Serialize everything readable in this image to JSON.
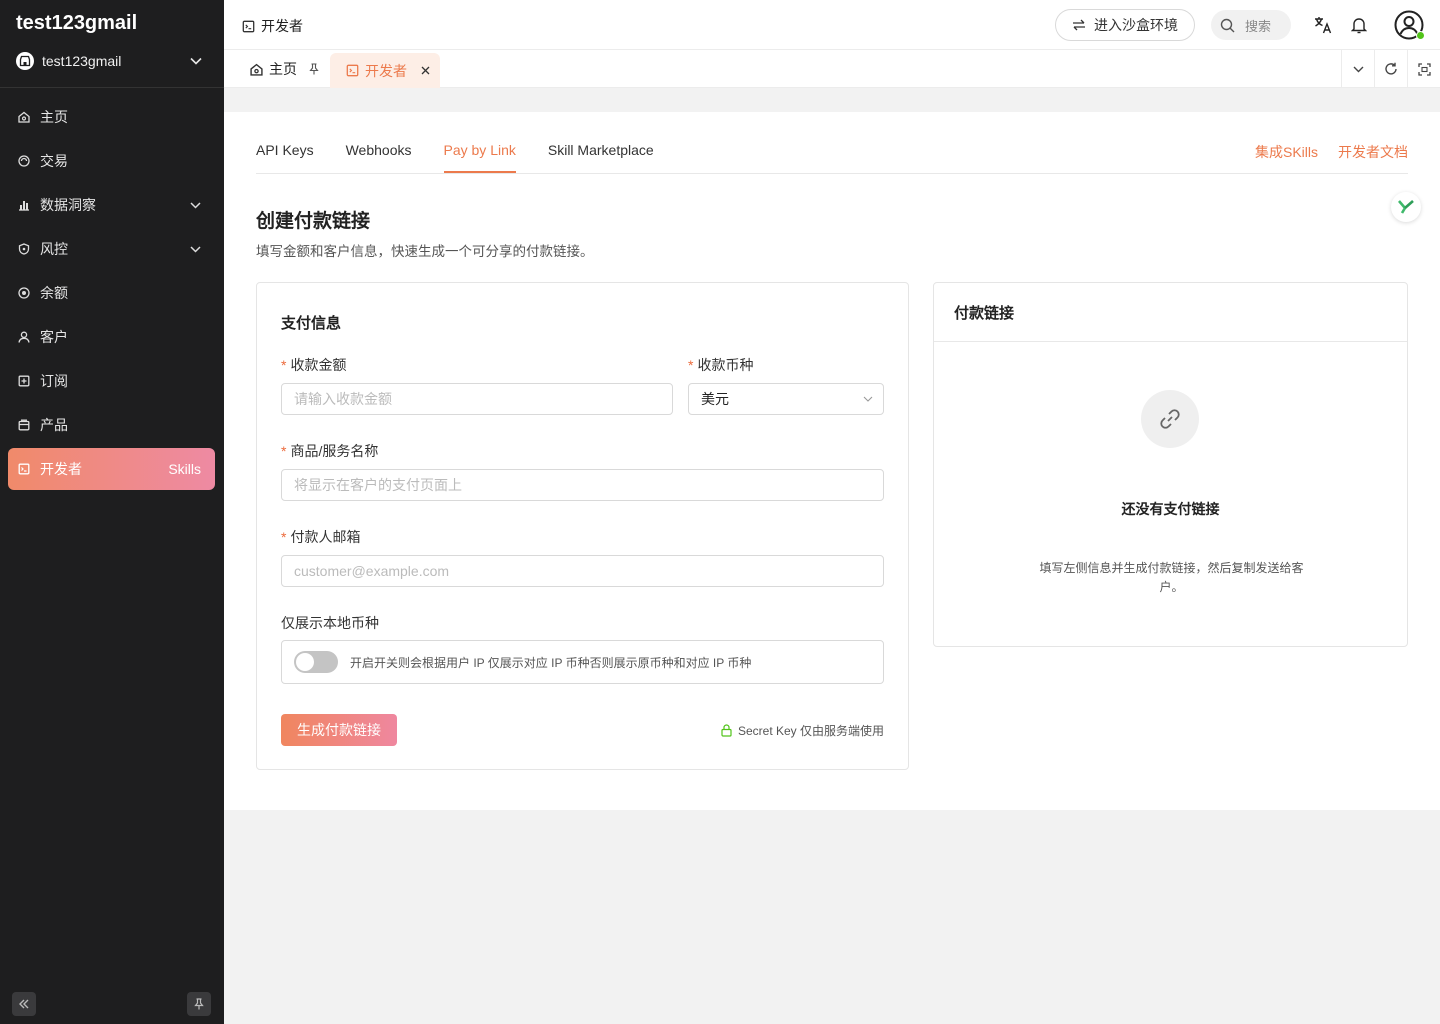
{
  "sidebar": {
    "brand": "test123gmail",
    "account_name": "test123gmail",
    "items": [
      {
        "label": "主页",
        "icon": "home-icon"
      },
      {
        "label": "交易",
        "icon": "transaction-icon"
      },
      {
        "label": "数据洞察",
        "icon": "chart-icon",
        "expandable": true
      },
      {
        "label": "风控",
        "icon": "shield-icon",
        "expandable": true
      },
      {
        "label": "余额",
        "icon": "balance-icon"
      },
      {
        "label": "客户",
        "icon": "user-icon"
      },
      {
        "label": "订阅",
        "icon": "subscription-icon"
      },
      {
        "label": "产品",
        "icon": "product-icon"
      },
      {
        "label": "开发者",
        "icon": "developer-icon",
        "active": true,
        "badge": "Skills"
      }
    ]
  },
  "topbar": {
    "title": "开发者",
    "sandbox_label": "进入沙盒环境",
    "search_placeholder": "搜索"
  },
  "tabs": {
    "home": "主页",
    "developer": "开发者"
  },
  "subtabs": [
    "API Keys",
    "Webhooks",
    "Pay by Link",
    "Skill Marketplace"
  ],
  "subtabs_active": "Pay by Link",
  "links": {
    "skills": "集成SKills",
    "docs": "开发者文档"
  },
  "page": {
    "title": "创建付款链接",
    "subtitle": "填写金额和客户信息，快速生成一个可分享的付款链接。"
  },
  "form": {
    "section_title": "支付信息",
    "amount_label": "收款金额",
    "amount_placeholder": "请输入收款金额",
    "currency_label": "收款币种",
    "currency_value": "美元",
    "product_label": "商品/服务名称",
    "product_placeholder": "将显示在客户的支付页面上",
    "email_label": "付款人邮箱",
    "email_placeholder": "customer@example.com",
    "local_currency_label": "仅展示本地币种",
    "toggle_desc": "开启开关则会根据用户 IP 仅展示对应 IP 币种否则展示原币种和对应 IP 币种",
    "toggle_on": false,
    "submit_label": "生成付款链接",
    "secret_note": "Secret Key 仅由服务端使用",
    "required_mark": "*"
  },
  "link_panel": {
    "title": "付款链接",
    "empty_title": "还没有支付链接",
    "empty_desc": "填写左侧信息并生成付款链接，然后复制发送给客户。"
  },
  "colors": {
    "accent": "#ec7a4c",
    "sidebar_bg": "#1e1e1f",
    "active_gradient_start": "#f08a6a",
    "active_gradient_end": "#ee8aa3"
  }
}
